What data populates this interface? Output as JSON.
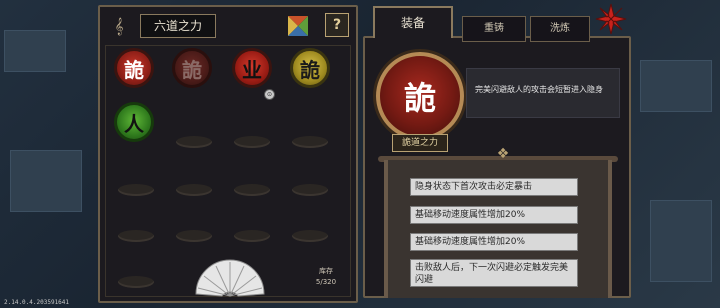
{
  "version": "2.14.0.4.203591641",
  "left_panel": {
    "title": "六道之力",
    "help_label": "?",
    "storage_label": "库存",
    "storage_count": "5/320",
    "runes": [
      {
        "glyph": "詭",
        "style": "red"
      },
      {
        "glyph": "詭",
        "style": "red-dim"
      },
      {
        "glyph": "业",
        "style": "ye"
      },
      {
        "glyph": "詭",
        "style": "gold"
      },
      {
        "glyph": "人",
        "style": "green"
      }
    ]
  },
  "right_panel": {
    "tabs": [
      "装备",
      "重铸",
      "洗炼"
    ],
    "selected_rune": {
      "glyph": "詭",
      "name": "詭道之力",
      "description": "完美闪避敌人的攻击会短暂进入隐身"
    },
    "effects": [
      "隐身状态下首次攻击必定暴击",
      "基础移动速度属性增加20%",
      "基础移动速度属性增加20%",
      "击败敌人后，下一次闪避必定触发完美闪避"
    ]
  },
  "colors": {
    "panel_bg": "#1c1a1f",
    "frame": "#6b5e4a",
    "accent_gold": "#b9a273",
    "rune_red": "#a8291f"
  }
}
